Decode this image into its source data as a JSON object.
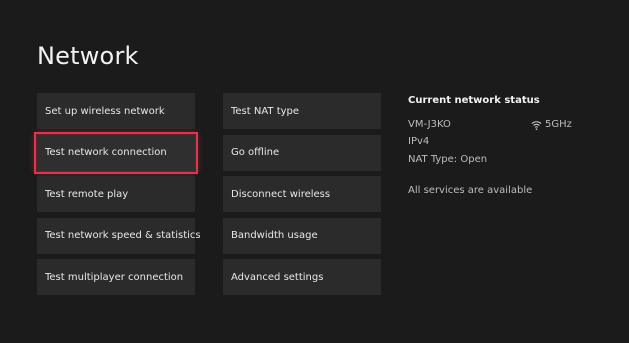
{
  "page": {
    "title": "Network"
  },
  "left_menu": [
    {
      "label": "Set up wireless network"
    },
    {
      "label": "Test network connection",
      "focused": true
    },
    {
      "label": "Test remote play"
    },
    {
      "label": "Test network speed & statistics"
    },
    {
      "label": "Test multiplayer connection"
    }
  ],
  "middle_menu": [
    {
      "label": "Test NAT type"
    },
    {
      "label": "Go offline"
    },
    {
      "label": "Disconnect wireless"
    },
    {
      "label": "Bandwidth usage"
    },
    {
      "label": "Advanced settings"
    }
  ],
  "status": {
    "title": "Current network status",
    "network_name": "VM-J3KO",
    "band": "5GHz",
    "band_icon": "wifi-icon",
    "ip_version": "IPv4",
    "nat_type": "NAT Type: Open",
    "services": "All services are available"
  },
  "colors": {
    "background": "#1b1b1b",
    "tile": "#2b2b2b",
    "focus": "#e0334d"
  }
}
